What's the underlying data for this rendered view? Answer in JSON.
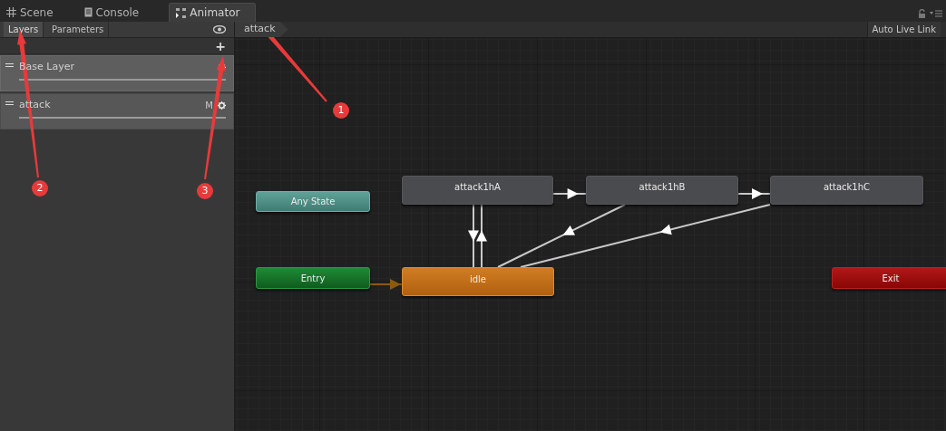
{
  "window_tabs": [
    {
      "label": "Scene",
      "selected": false
    },
    {
      "label": "Console",
      "selected": false
    },
    {
      "label": "Animator",
      "selected": true
    }
  ],
  "side_tabs": [
    {
      "label": "Layers",
      "selected": true
    },
    {
      "label": "Parameters",
      "selected": false
    }
  ],
  "add_button": "+",
  "layers": [
    {
      "name": "Base Layer",
      "selected": true
    },
    {
      "name": "attack",
      "selected": false,
      "badge": "M"
    }
  ],
  "breadcrumb": [
    "attack"
  ],
  "auto_live_link": "Auto Live Link",
  "states": [
    {
      "name": "Any State",
      "kind": "any"
    },
    {
      "name": "Entry",
      "kind": "entry"
    },
    {
      "name": "attack1hA",
      "kind": "state"
    },
    {
      "name": "idle",
      "kind": "default"
    },
    {
      "name": "attack1hB",
      "kind": "state"
    },
    {
      "name": "attack1hC",
      "kind": "state"
    },
    {
      "name": "Exit",
      "kind": "exit"
    }
  ],
  "annotations": [
    {
      "label": "1"
    },
    {
      "label": "2"
    },
    {
      "label": "3"
    }
  ]
}
